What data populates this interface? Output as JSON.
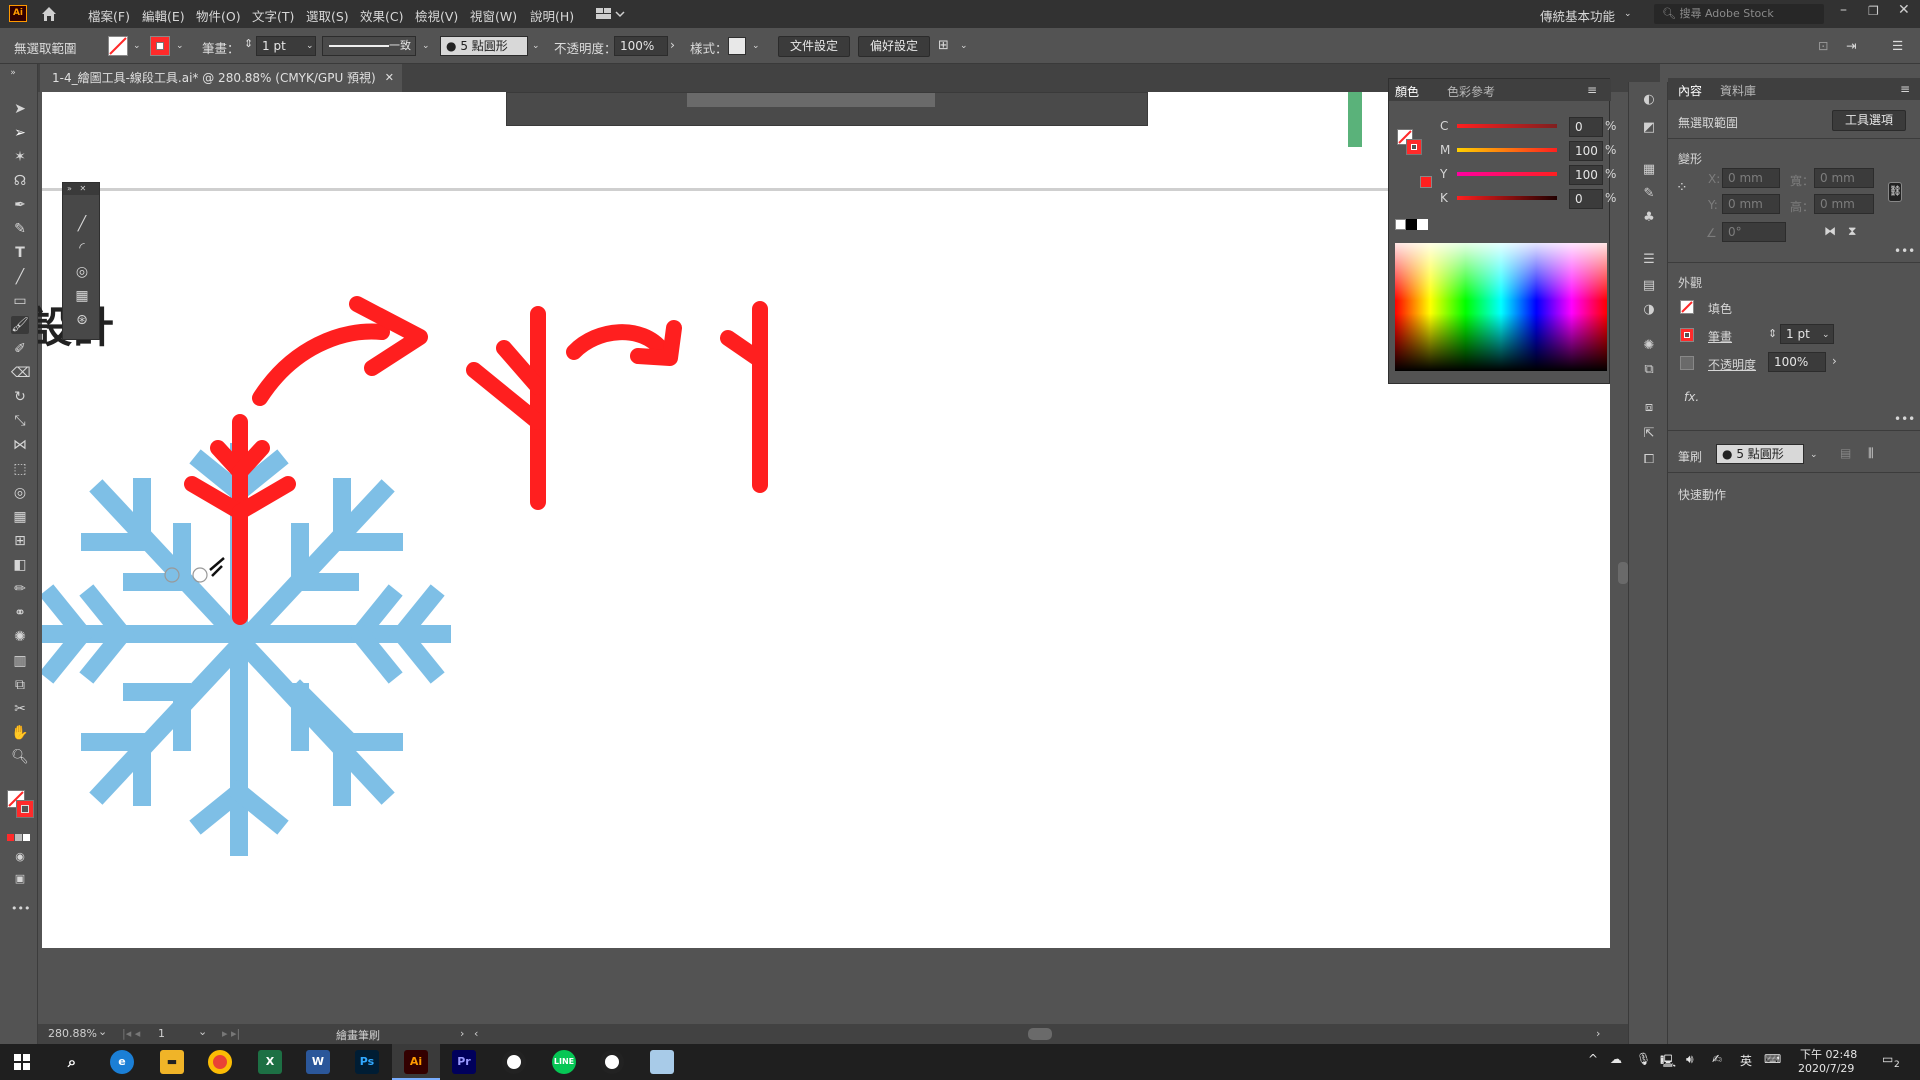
{
  "app": {
    "logo": "Ai",
    "menu": [
      "檔案(F)",
      "編輯(E)",
      "物件(O)",
      "文字(T)",
      "選取(S)",
      "效果(C)",
      "檢視(V)",
      "視窗(W)",
      "說明(H)"
    ],
    "workspace": "傳統基本功能",
    "stock_placeholder": "搜尋 Adobe Stock"
  },
  "control_bar": {
    "selection": "無選取範圍",
    "stroke_label": "筆畫：",
    "stroke_value": "1 pt",
    "profile": "一致",
    "brush": "5 點圓形",
    "opacity_label": "不透明度：",
    "opacity_value": "100%",
    "style_label": "樣式：",
    "doc_setup_button": "文件設定",
    "prefs_button": "偏好設定"
  },
  "document": {
    "tab_title": "1-4_繪圖工具-線段工具.ai* @ 280.88% (CMYK/GPU 預視)",
    "canvas_text": "設計"
  },
  "color_panel": {
    "tab_color": "顏色",
    "tab_guide": "色彩參考",
    "channels": [
      {
        "name": "C",
        "value": "0",
        "unit": "%"
      },
      {
        "name": "M",
        "value": "100",
        "unit": "%"
      },
      {
        "name": "Y",
        "value": "100",
        "unit": "%"
      },
      {
        "name": "K",
        "value": "0",
        "unit": "%"
      }
    ]
  },
  "properties": {
    "tab_props": "內容",
    "tab_library": "資料庫",
    "no_selection": "無選取範圍",
    "tool_options_button": "工具選項",
    "transform_title": "變形",
    "x_label": "X:",
    "y_label": "Y:",
    "w_label": "寬：",
    "h_label": "高：",
    "mm_placeholder": "0 mm",
    "angle_placeholder": "0°",
    "appearance_title": "外觀",
    "fill_label": "填色",
    "stroke_label": "筆畫",
    "stroke_value": "1 pt",
    "opacity_label": "不透明度",
    "opacity_value": "100%",
    "fx_label": "fx.",
    "brush_label": "筆刷",
    "brush_value": "5 點圓形",
    "quick_actions": "快速動作"
  },
  "status": {
    "zoom": "280.88%",
    "artboard": "1",
    "tool": "繪畫筆刷"
  },
  "taskbar": {
    "time": "下午 02:48",
    "date": "2020/7/29",
    "ime": "英",
    "notif_count": "2",
    "apps": [
      "start",
      "search",
      "edge",
      "explorer",
      "chrome",
      "excel",
      "word",
      "photoshop",
      "illustrator",
      "premiere",
      "recorder",
      "line",
      "recorder-2",
      "notepad"
    ]
  },
  "colors": {
    "accent_red": "#ff1f1f",
    "snowflake_blue": "#7ebfe6",
    "ui_dark": "#323232",
    "ui_panel": "#535353"
  }
}
